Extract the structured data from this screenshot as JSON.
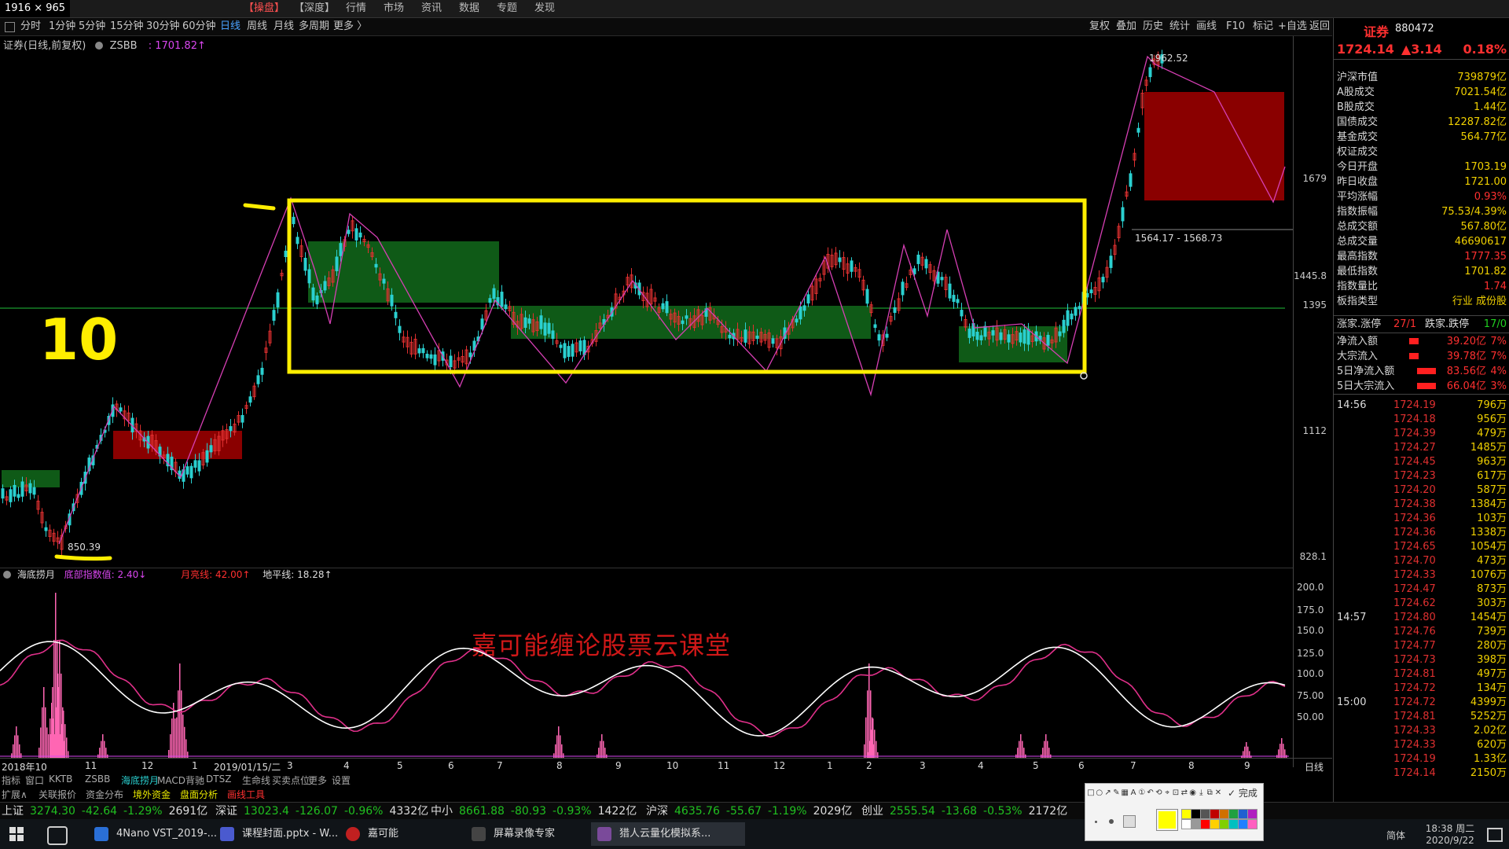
{
  "top_menu": {
    "dim_label": "1916 × 965",
    "items": [
      "【操盘】",
      "【深度】",
      "行情",
      "市场",
      "资讯",
      "数据",
      "专题",
      "发现"
    ]
  },
  "period_bar": {
    "periods": [
      "分时",
      "1分钟",
      "5分钟",
      "15分钟",
      "30分钟",
      "60分钟",
      "日线",
      "周线",
      "月线",
      "多周期",
      "更多 〉"
    ],
    "active": "日线",
    "right_tools": [
      "复权",
      "叠加",
      "历史",
      "统计",
      "画线",
      "F10",
      "标记",
      "+自选",
      "返回"
    ]
  },
  "chart": {
    "title_name": "证券(日线,前复权)",
    "title_code": "ZSBB",
    "title_value": ": 1701.82↑",
    "price_levels": [
      "1679",
      "1445.8",
      "1395",
      "1112",
      "828.1"
    ],
    "labels": {
      "high": "1962.52",
      "low": "850.39",
      "range": "1564.17 - 1568.73"
    },
    "watermark": "嘉可能缠论股票云课堂",
    "handwriting": "10",
    "x_axis": [
      "2018年10",
      "11",
      "12",
      "1",
      "2019/01/15/二",
      "3",
      "4",
      "5",
      "6",
      "7",
      "8",
      "9",
      "10",
      "11",
      "12",
      "1",
      "2",
      "3",
      "4",
      "5",
      "6",
      "7",
      "8",
      "9"
    ],
    "x_axis_right": "日线",
    "colors": {
      "box": "#ffee00",
      "zone_green": "#0f5a17",
      "zone_red": "#8a0000",
      "line": "#d63fb4",
      "up": "#e03030",
      "down": "#2ad0d0"
    }
  },
  "indicator": {
    "name": "海底捞月",
    "field1": "底部指数值: 2.40↓",
    "field2": "月亮线: 42.00↑",
    "field3": "地平线: 18.28↑",
    "levels": [
      "200.0",
      "175.0",
      "150.0",
      "125.0",
      "100.0",
      "75.00",
      "50.00"
    ]
  },
  "func_bar": {
    "items": [
      "指标",
      "窗口",
      "KKTB",
      "ZSBB",
      "海底捞月",
      "MACD背驰",
      "DTSZ",
      "生命线",
      "买卖点位",
      "更多",
      "设置"
    ],
    "items2": [
      "扩展∧",
      "关联报价",
      "资金分布",
      "境外资金",
      "盘面分析",
      "画线工具"
    ]
  },
  "ticker": [
    {
      "name": "上证",
      "price": "3274.30",
      "chg": "-42.64",
      "pct": "-1.29%",
      "amt": "2691亿"
    },
    {
      "name": "深证",
      "price": "13023.4",
      "chg": "-126.07",
      "pct": "-0.96%",
      "amt": "4332亿"
    },
    {
      "name": "中小",
      "price": "8661.88",
      "chg": "-80.93",
      "pct": "-0.93%",
      "amt": "1422亿"
    },
    {
      "name": "沪深",
      "price": "4635.76",
      "chg": "-55.67",
      "pct": "-1.19%",
      "amt": "2029亿"
    },
    {
      "name": "创业",
      "price": "2555.54",
      "chg": "-13.68",
      "pct": "-0.53%",
      "amt": "2172亿"
    }
  ],
  "taskbar": {
    "tasks": [
      "4Nano VST_2019-...",
      "课程封面.pptx - W...",
      "嘉可能",
      "屏幕录像专家",
      "猎人云量化模拟系..."
    ],
    "clock_time": "18:38 周二",
    "clock_date": "2020/9/22",
    "ime": "简体"
  },
  "right_panel": {
    "name": "证券",
    "code": "880472",
    "price": "1724.14",
    "change": "▲3.14",
    "pct": "0.18%",
    "stats": [
      {
        "k": "沪深市值",
        "v": "739879亿"
      },
      {
        "k": "A股成交",
        "v": "7021.54亿"
      },
      {
        "k": "B股成交",
        "v": "1.44亿"
      },
      {
        "k": "国债成交",
        "v": "12287.82亿"
      },
      {
        "k": "基金成交",
        "v": "564.77亿"
      },
      {
        "k": "权证成交",
        "v": ""
      },
      {
        "k": "今日开盘",
        "v": "1703.19"
      },
      {
        "k": "昨日收盘",
        "v": "1721.00"
      },
      {
        "k": "平均涨幅",
        "v": "0.93%"
      },
      {
        "k": "指数振幅",
        "v": "75.53/4.39%"
      },
      {
        "k": "总成交额",
        "v": "567.80亿"
      },
      {
        "k": "总成交量",
        "v": "46690617"
      },
      {
        "k": "最高指数",
        "v": "1777.35"
      },
      {
        "k": "最低指数",
        "v": "1701.82"
      },
      {
        "k": "指数量比",
        "v": "1.74"
      },
      {
        "k": "板指类型",
        "v": "行业 成份股"
      }
    ],
    "updown": {
      "k1": "涨家.涨停",
      "v1": "27/1",
      "k2": "跌家.跌停",
      "v2": "17/0"
    },
    "flows": [
      {
        "k": "净流入额",
        "v": "39.20亿",
        "p": "7%"
      },
      {
        "k": "大宗流入",
        "v": "39.78亿",
        "p": "7%"
      },
      {
        "k": "5日净流入额",
        "v": "83.56亿",
        "p": "4%"
      },
      {
        "k": "5日大宗流入",
        "v": "66.04亿",
        "p": "3%"
      }
    ],
    "ticks": [
      {
        "t": "14:56",
        "p": "1724.19",
        "v": "796万"
      },
      {
        "t": "",
        "p": "1724.18",
        "v": "956万"
      },
      {
        "t": "",
        "p": "1724.39",
        "v": "479万"
      },
      {
        "t": "",
        "p": "1724.27",
        "v": "1485万"
      },
      {
        "t": "",
        "p": "1724.45",
        "v": "963万"
      },
      {
        "t": "",
        "p": "1724.23",
        "v": "617万"
      },
      {
        "t": "",
        "p": "1724.20",
        "v": "587万"
      },
      {
        "t": "",
        "p": "1724.38",
        "v": "1384万"
      },
      {
        "t": "",
        "p": "1724.36",
        "v": "103万"
      },
      {
        "t": "",
        "p": "1724.36",
        "v": "1338万"
      },
      {
        "t": "",
        "p": "1724.65",
        "v": "1054万"
      },
      {
        "t": "",
        "p": "1724.70",
        "v": "473万"
      },
      {
        "t": "",
        "p": "1724.33",
        "v": "1076万"
      },
      {
        "t": "",
        "p": "1724.47",
        "v": "873万"
      },
      {
        "t": "",
        "p": "1724.62",
        "v": "303万"
      },
      {
        "t": "14:57",
        "p": "1724.80",
        "v": "1454万"
      },
      {
        "t": "",
        "p": "1724.76",
        "v": "739万"
      },
      {
        "t": "",
        "p": "1724.77",
        "v": "280万"
      },
      {
        "t": "",
        "p": "1724.73",
        "v": "398万"
      },
      {
        "t": "",
        "p": "1724.81",
        "v": "497万"
      },
      {
        "t": "",
        "p": "1724.72",
        "v": "134万"
      },
      {
        "t": "15:00",
        "p": "1724.72",
        "v": "4399万"
      },
      {
        "t": "",
        "p": "1724.81",
        "v": "5252万"
      },
      {
        "t": "",
        "p": "1724.33",
        "v": "2.02亿"
      },
      {
        "t": "",
        "p": "1724.33",
        "v": "620万"
      },
      {
        "t": "",
        "p": "1724.19",
        "v": "1.33亿"
      },
      {
        "t": "",
        "p": "1724.14",
        "v": "2150万"
      }
    ]
  },
  "draw_toolbar": {
    "tools": [
      "rect-icon",
      "circle-icon",
      "arrow-icon",
      "pen-icon",
      "mosaic-icon",
      "text-icon",
      "number-icon",
      "undo-icon",
      "redo-icon",
      "pin-icon",
      "ocr-icon",
      "translate-icon",
      "record-icon",
      "download-icon",
      "copy-icon",
      "close-icon"
    ],
    "done_label": "完成",
    "swatches": [
      "#ffff00",
      "#000000",
      "#555555",
      "#c00000",
      "#d07000",
      "#20a040",
      "#2060d0",
      "#b020c0",
      "#ffffff",
      "#999999",
      "#ff0000",
      "#ffd000",
      "#80d000",
      "#00c0c0",
      "#2080ff",
      "#ff60c0"
    ]
  }
}
